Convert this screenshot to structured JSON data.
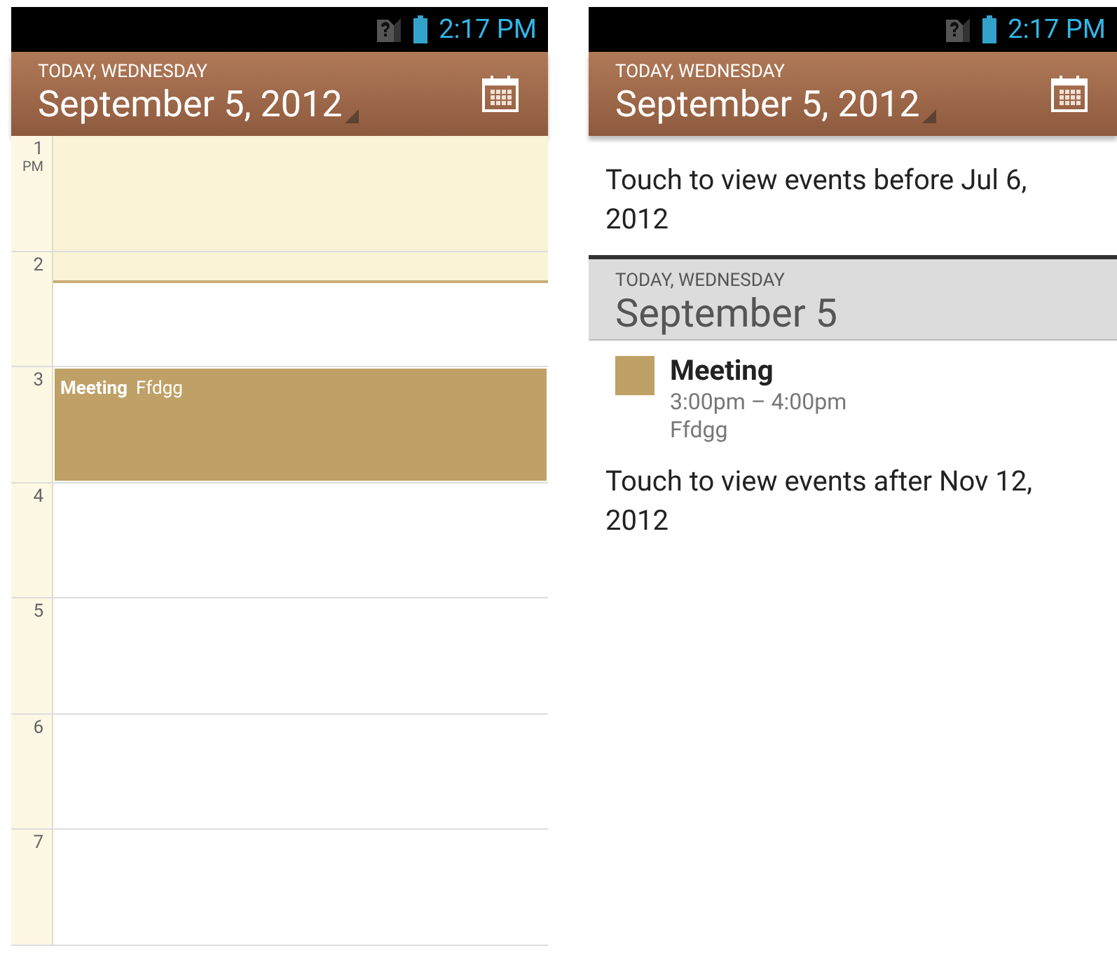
{
  "screens": [
    {
      "kind": "day",
      "status_bar": {
        "time": "2:17 PM"
      },
      "header": {
        "subtitle": "TODAY, WEDNESDAY",
        "title": "September 5, 2012"
      },
      "hours": [
        {
          "label": "1",
          "suffix": "PM",
          "kind": "past"
        },
        {
          "label": "2",
          "kind": "current"
        },
        {
          "label": "3",
          "kind": "future",
          "events": [
            {
              "title": "Meeting",
              "location": "Ffdgg",
              "color": "#bfa066"
            }
          ]
        },
        {
          "label": "4",
          "kind": "future"
        },
        {
          "label": "5",
          "kind": "future"
        },
        {
          "label": "6",
          "kind": "future"
        },
        {
          "label": "7",
          "kind": "future"
        }
      ]
    },
    {
      "kind": "agenda",
      "status_bar": {
        "time": "2:17 PM"
      },
      "header": {
        "subtitle": "TODAY, WEDNESDAY",
        "title": "September 5, 2012"
      },
      "load_before": "Touch to view events before Jul 6, 2012",
      "day": {
        "subtitle": "TODAY, WEDNESDAY",
        "title": "September 5"
      },
      "events": [
        {
          "title": "Meeting",
          "time": "3:00pm – 4:00pm",
          "location": "Ffdgg",
          "color": "#bfa066"
        }
      ],
      "load_after": "Touch to view events after Nov 12, 2012"
    }
  ]
}
